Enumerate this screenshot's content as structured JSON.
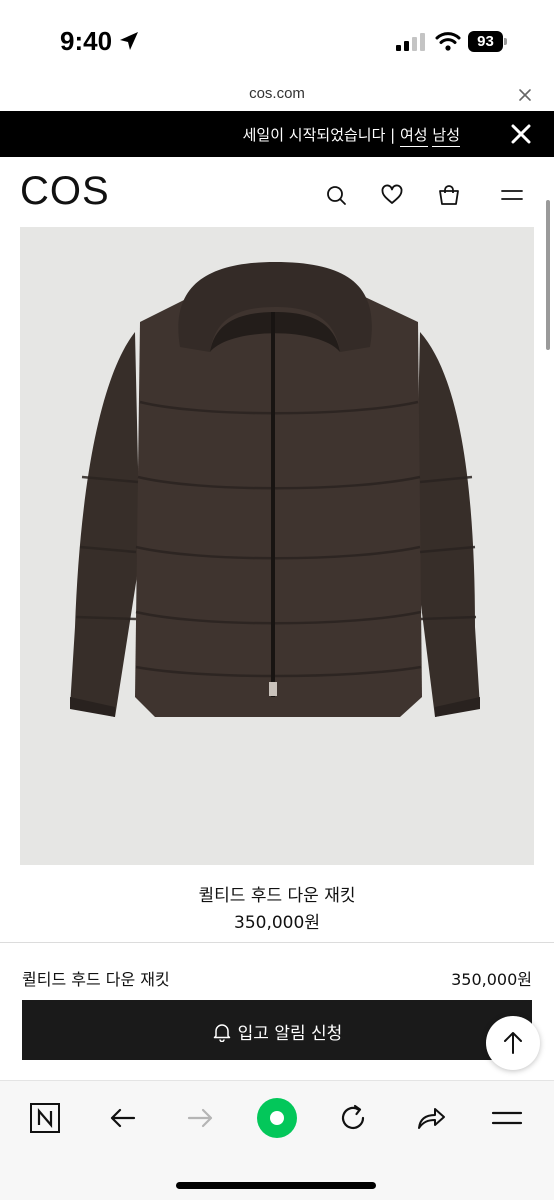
{
  "status": {
    "time": "9:40",
    "battery": "93"
  },
  "browser": {
    "url": "cos.com"
  },
  "announcement": {
    "text": "세일이 시작되었습니다 |",
    "link_women": "여성",
    "link_men": "남성"
  },
  "header": {
    "logo": "COS"
  },
  "product": {
    "name": "퀼티드 후드 다운 재킷",
    "price": "350,000원",
    "image_description": "dark brown quilted hooded down jacket"
  },
  "sticky_bar": {
    "name": "퀼티드 후드 다운 재킷",
    "price": "350,000원",
    "notify_label": "입고 알림 신청"
  },
  "icons": {
    "header": [
      "search-icon",
      "heart-icon",
      "bag-icon",
      "menu-icon"
    ],
    "toolbar": [
      "naver-n-icon",
      "back-arrow-icon",
      "forward-arrow-icon",
      "green-dot-home-icon",
      "refresh-icon",
      "share-icon",
      "menu-icon"
    ]
  },
  "colors": {
    "announce_bg": "#000000",
    "button_bg": "#1a1a1a",
    "accent_green": "#03c75a",
    "jacket": "#3a302b"
  }
}
